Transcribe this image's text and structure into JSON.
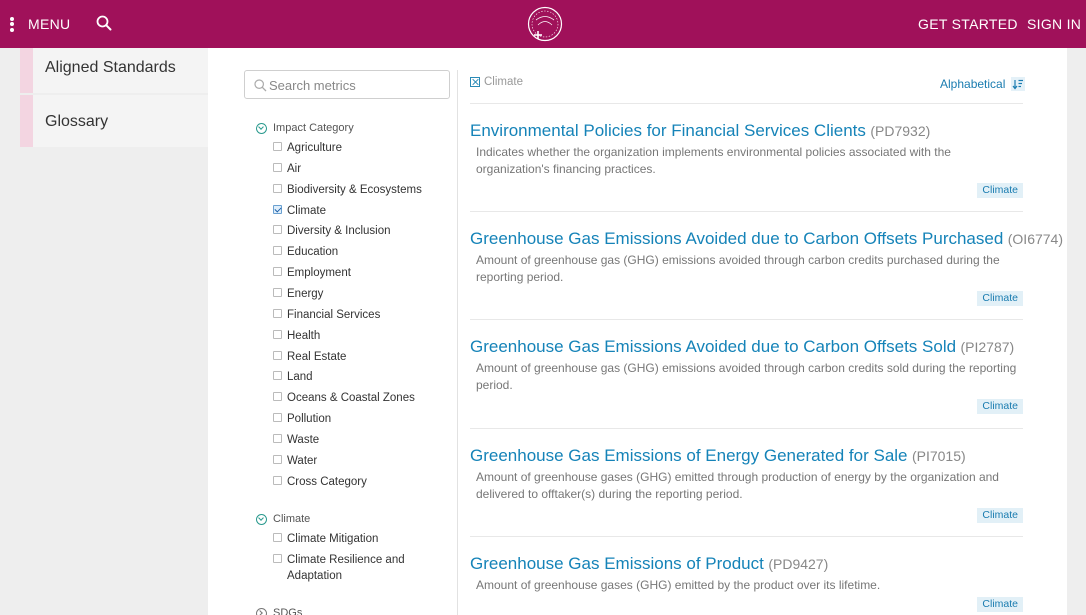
{
  "header": {
    "menu_label": "MENU",
    "get_started": "GET STARTED",
    "sign_in": "SIGN IN",
    "brand_color": "#a0115a"
  },
  "leftnav": {
    "items": [
      {
        "label": "Aligned Standards"
      },
      {
        "label": "Glossary"
      }
    ]
  },
  "search": {
    "placeholder": "Search metrics"
  },
  "filters": {
    "impact_category": {
      "label": "Impact Category",
      "options": [
        {
          "label": "Agriculture",
          "checked": false
        },
        {
          "label": "Air",
          "checked": false
        },
        {
          "label": "Biodiversity & Ecosystems",
          "checked": false
        },
        {
          "label": "Climate",
          "checked": true
        },
        {
          "label": "Diversity & Inclusion",
          "checked": false
        },
        {
          "label": "Education",
          "checked": false
        },
        {
          "label": "Employment",
          "checked": false
        },
        {
          "label": "Energy",
          "checked": false
        },
        {
          "label": "Financial Services",
          "checked": false
        },
        {
          "label": "Health",
          "checked": false
        },
        {
          "label": "Real Estate",
          "checked": false
        },
        {
          "label": "Land",
          "checked": false
        },
        {
          "label": "Oceans & Coastal Zones",
          "checked": false
        },
        {
          "label": "Pollution",
          "checked": false
        },
        {
          "label": "Waste",
          "checked": false
        },
        {
          "label": "Water",
          "checked": false
        },
        {
          "label": "Cross Category",
          "checked": false
        }
      ]
    },
    "climate": {
      "label": "Climate",
      "options": [
        {
          "label": "Climate Mitigation",
          "checked": false
        },
        {
          "label": "Climate Resilience and Adaptation",
          "checked": false
        }
      ]
    },
    "sdgs": {
      "label": "SDGs"
    }
  },
  "results_header": {
    "active_filter": "Climate",
    "sort_label": "Alphabetical"
  },
  "results": [
    {
      "name": "Environmental Policies for Financial Services Clients",
      "code": "(PD7932)",
      "description": "Indicates whether the organization implements environmental policies associated with the organization's financing practices.",
      "tag": "Climate"
    },
    {
      "name": "Greenhouse Gas Emissions Avoided due to Carbon Offsets Purchased",
      "code": "(OI6774)",
      "description": "Amount of greenhouse gas (GHG) emissions avoided through carbon credits purchased during the reporting period.",
      "tag": "Climate"
    },
    {
      "name": "Greenhouse Gas Emissions Avoided due to Carbon Offsets Sold",
      "code": "(PI2787)",
      "description": "Amount of greenhouse gas (GHG) emissions avoided through carbon credits sold during the reporting period.",
      "tag": "Climate"
    },
    {
      "name": "Greenhouse Gas Emissions of Energy Generated for Sale",
      "code": "(PI7015)",
      "description": "Amount of greenhouse gases (GHG) emitted through production of energy by the organization and delivered to offtaker(s) during the reporting period.",
      "tag": "Climate"
    },
    {
      "name": "Greenhouse Gas Emissions of Product",
      "code": "(PD9427)",
      "description": "Amount of greenhouse gases (GHG) emitted by the product over its lifetime.",
      "tag": "Climate"
    }
  ]
}
